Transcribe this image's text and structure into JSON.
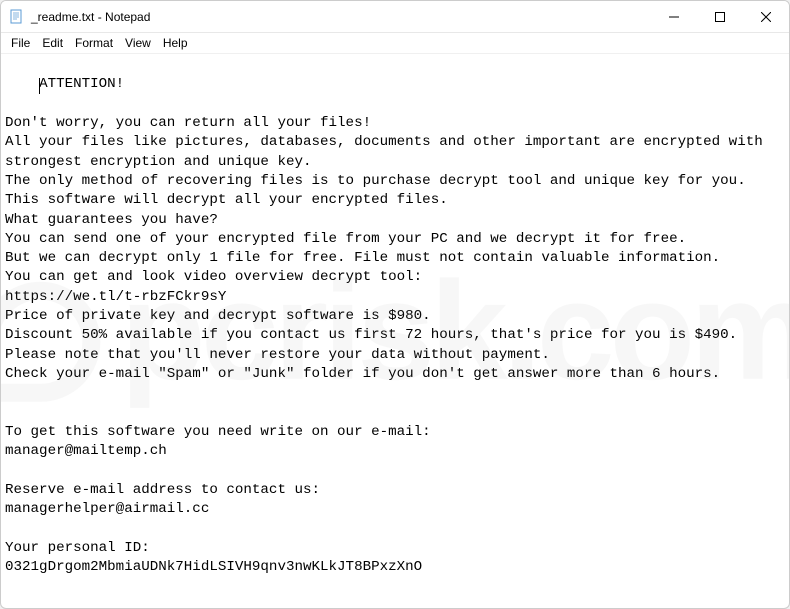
{
  "titlebar": {
    "title": "_readme.txt - Notepad"
  },
  "menubar": {
    "items": [
      {
        "label": "File"
      },
      {
        "label": "Edit"
      },
      {
        "label": "Format"
      },
      {
        "label": "View"
      },
      {
        "label": "Help"
      }
    ]
  },
  "content": {
    "text": "ATTENTION!\n\nDon't worry, you can return all your files!\nAll your files like pictures, databases, documents and other important are encrypted with strongest encryption and unique key.\nThe only method of recovering files is to purchase decrypt tool and unique key for you.\nThis software will decrypt all your encrypted files.\nWhat guarantees you have?\nYou can send one of your encrypted file from your PC and we decrypt it for free.\nBut we can decrypt only 1 file for free. File must not contain valuable information.\nYou can get and look video overview decrypt tool:\nhttps://we.tl/t-rbzFCkr9sY\nPrice of private key and decrypt software is $980.\nDiscount 50% available if you contact us first 72 hours, that's price for you is $490.\nPlease note that you'll never restore your data without payment.\nCheck your e-mail \"Spam\" or \"Junk\" folder if you don't get answer more than 6 hours.\n\n\nTo get this software you need write on our e-mail:\nmanager@mailtemp.ch\n\nReserve e-mail address to contact us:\nmanagerhelper@airmail.cc\n\nYour personal ID:\n0321gDrgom2MbmiaUDNk7HidLSIVH9qnv3nwKLkJT8BPxzXnO"
  }
}
